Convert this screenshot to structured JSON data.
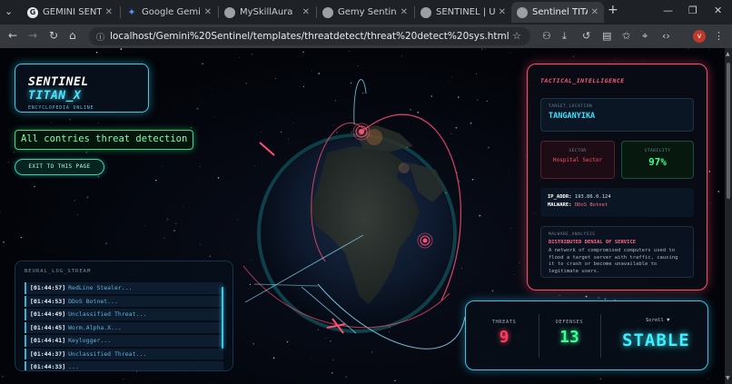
{
  "browser": {
    "tabs": [
      {
        "title": "GEMINI SENTINEL",
        "icon": "github-icon",
        "color": "#e8eaed"
      },
      {
        "title": "Google Gemini",
        "icon": "gemini-icon",
        "color": "#4f8ef7"
      },
      {
        "title": "MySkillAura",
        "icon": "globe-icon",
        "color": "#9aa0a6"
      },
      {
        "title": "Gemy Sentinel - Fl",
        "icon": "globe-icon",
        "color": "#9aa0a6"
      },
      {
        "title": "SENTINEL | Ultima",
        "icon": "globe-icon",
        "color": "#9aa0a6"
      },
      {
        "title": "Sentinel TITAN",
        "icon": "globe-icon",
        "color": "#9aa0a6"
      }
    ],
    "url": "localhost/Gemini%20Sentinel/templates/threatdetect/threat%20detect%20sys.html",
    "profile_initial": "v"
  },
  "logo": {
    "title_main": "SENTINEL",
    "title_accent": "TITAN_X",
    "subtitle": "ENCYCLOPEDIA ONLINE"
  },
  "heading": "All contries threat detection",
  "exit_button": "EXIT TO THIS PAGE",
  "log": {
    "title": "NEURAL_LOG_STREAM",
    "items": [
      {
        "time": "[01:44:57]",
        "text": "RedLine Stealer..."
      },
      {
        "time": "[01:44:53]",
        "text": "DDoS Botnet..."
      },
      {
        "time": "[01:44:49]",
        "text": "Unclassified Threat..."
      },
      {
        "time": "[01:44:45]",
        "text": "Worm.Alpha.X..."
      },
      {
        "time": "[01:44:41]",
        "text": "Keylogger..."
      },
      {
        "time": "[01:44:37]",
        "text": "Unclassified Threat..."
      },
      {
        "time": "[01:44:33]",
        "text": "..."
      }
    ]
  },
  "intel": {
    "title": "TACTICAL_INTELLIGENCE",
    "location_label": "TARGET_LOCATION",
    "location_value": "TANGANYIKA",
    "sector_label": "SECTOR",
    "sector_value": "Hospital Sector",
    "stability_label": "STABILITY",
    "stability_value": "97%",
    "ip_label": "IP_ADDR:",
    "ip_value": "193.86.0.124",
    "malware_label": "MALWARE:",
    "malware_value": "DDoS Botnet",
    "analysis_label": "MALWARE_ANALYSIS",
    "analysis_title": "DISTRIBUTED DENIAL OF SERVICE",
    "analysis_desc": "A network of compromised computers used to flood a target server with traffic, causing it to crash or become unavailable to legitimate users."
  },
  "stats": {
    "threats_label": "THREATS",
    "threats_value": "9",
    "defenses_label": "DEFENSES",
    "defenses_value": "13",
    "scroll_label": "Scroll ▼",
    "status": "STABLE"
  },
  "colors": {
    "threat": "#ff3b5c",
    "defense": "#3bff94",
    "accent": "#3ef0ff"
  }
}
